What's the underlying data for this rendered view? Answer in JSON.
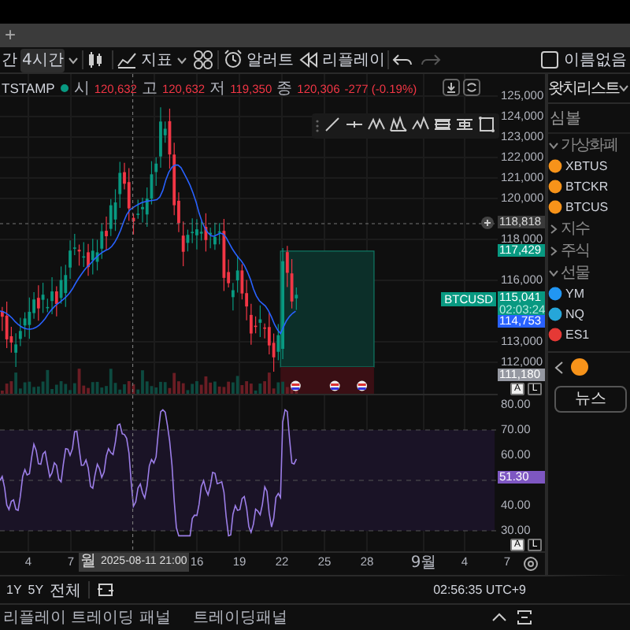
{
  "tab_bar": {
    "new_tab": "+"
  },
  "toolbar": {
    "items": [
      {
        "kind": "interval",
        "label": "간",
        "selected": false
      },
      {
        "kind": "interval",
        "label": "4시간",
        "selected": true
      },
      {
        "kind": "caret"
      },
      {
        "kind": "chart_type"
      },
      {
        "kind": "indicators",
        "label": "지표"
      },
      {
        "kind": "caret"
      },
      {
        "kind": "templates"
      },
      {
        "kind": "alert",
        "label": "알러트"
      },
      {
        "kind": "replay",
        "label": "리플레이"
      },
      {
        "kind": "undo",
        "disabled": false
      },
      {
        "kind": "redo",
        "disabled": true
      }
    ],
    "layout_name": "이름없음"
  },
  "legend": {
    "symbol": "TSTAMP",
    "fields": [
      {
        "label": "시",
        "value": "120,632"
      },
      {
        "label": "고",
        "value": "120,632"
      },
      {
        "label": "저",
        "value": "119,350"
      },
      {
        "label": "종",
        "value": "120,306"
      }
    ],
    "change": "-277 (-0.19%)"
  },
  "drawing_toolbar": [
    {
      "kind": "trend_line"
    },
    {
      "kind": "horizontal_ray"
    },
    {
      "kind": "pattern"
    },
    {
      "kind": "pattern_peaks"
    },
    {
      "kind": "wave"
    },
    {
      "kind": "fib"
    },
    {
      "kind": "range"
    },
    {
      "kind": "rectangle"
    }
  ],
  "price_axis": {
    "ticks": [
      "125,000",
      "124,000",
      "123,000",
      "122,000",
      "121,000",
      "120,000",
      "118,000",
      "116,000",
      "113,000",
      "112,000"
    ],
    "markers": [
      {
        "kind": "crosshair",
        "label": "118,818"
      },
      {
        "kind": "target",
        "label": "117,429"
      },
      {
        "kind": "last",
        "label": "115,041",
        "countdown": "02:03:24",
        "symbol": "BTCUSD"
      },
      {
        "kind": "stop",
        "label": "114,753"
      },
      {
        "kind": "entry",
        "label": "111,180"
      }
    ],
    "buttons": [
      "A",
      "L"
    ]
  },
  "rsi": {
    "ticks": [
      "80.00",
      "70.00",
      "60.00",
      "40.00",
      "30.00"
    ],
    "value": "51.30",
    "buttons": [
      "A",
      "L"
    ]
  },
  "time_axis": {
    "ticks": [
      "4",
      "7",
      "16",
      "19",
      "22",
      "25",
      "28",
      "9월",
      "4",
      "7"
    ],
    "crosshair_label": "월 2025-08-11  21:00"
  },
  "bottom_bar": {
    "ranges": [
      "1Y",
      "5Y",
      "전체"
    ],
    "clock": "02:56:35 UTC+9"
  },
  "panel": {
    "tabs": [
      "리플레이 트레이딩 패널",
      "트레이딩패널"
    ]
  },
  "sidebar": {
    "title": "왓치리스트",
    "column": "심볼",
    "groups": [
      {
        "name": "가상화폐",
        "expanded": true,
        "items": [
          {
            "symbol": "XBTUS",
            "color": "#f7931a"
          },
          {
            "symbol": "BTCKR",
            "color": "#f7931a"
          },
          {
            "symbol": "BTCUS",
            "color": "#f7931a"
          }
        ]
      },
      {
        "name": "지수",
        "expanded": false
      },
      {
        "name": "주식",
        "expanded": false
      },
      {
        "name": "선물",
        "expanded": true,
        "items": [
          {
            "symbol": "YM",
            "color": "#2196f3"
          },
          {
            "symbol": "NQ",
            "color": "#26a6d9"
          },
          {
            "symbol": "ES1",
            "color": "#e53935"
          }
        ]
      }
    ],
    "news_button": "뉴스"
  }
}
